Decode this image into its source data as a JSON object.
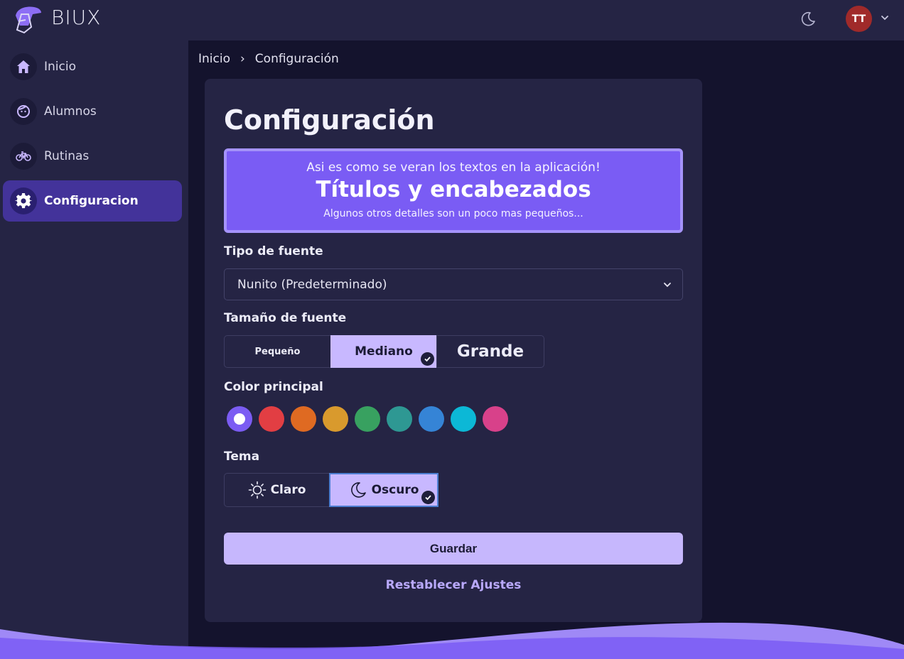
{
  "app": {
    "brand": "BIUX"
  },
  "header": {
    "avatar_initials": "TT",
    "theme_icon": "moon-icon"
  },
  "sidebar": {
    "items": [
      {
        "label": "Inicio",
        "icon": "home-icon",
        "active": false
      },
      {
        "label": "Alumnos",
        "icon": "face-icon",
        "active": false
      },
      {
        "label": "Rutinas",
        "icon": "bicycle-icon",
        "active": false
      },
      {
        "label": "Configuracion",
        "icon": "gear-icon",
        "active": true
      }
    ]
  },
  "breadcrumb": {
    "home": "Inicio",
    "separator": "›",
    "current": "Configuración"
  },
  "page": {
    "title": "Configuración"
  },
  "preview": {
    "line1": "Asi es como se veran los textos en la aplicación!",
    "line2": "Títulos y encabezados",
    "line3": "Algunos otros detalles son un poco mas pequeños..."
  },
  "font_type": {
    "label": "Tipo de fuente",
    "selected": "Nunito (Predeterminado)"
  },
  "font_size": {
    "label": "Tamaño de fuente",
    "options": [
      "Pequeño",
      "Mediano",
      "Grande"
    ],
    "selected": "Mediano"
  },
  "color": {
    "label": "Color principal",
    "swatches": [
      "#7b5cf3",
      "#e23e43",
      "#df6a22",
      "#d99a2d",
      "#38a160",
      "#2e9893",
      "#3584d6",
      "#0cb8d6",
      "#d8418a"
    ],
    "selected_index": 0
  },
  "theme": {
    "label": "Tema",
    "options": [
      {
        "label": "Claro",
        "icon": "sun-icon"
      },
      {
        "label": "Oscuro",
        "icon": "moon-icon"
      }
    ],
    "selected": "Oscuro"
  },
  "actions": {
    "save": "Guardar",
    "reset": "Restablecer Ajustes"
  },
  "colors": {
    "accent": "#7a5cf4",
    "accent_light": "#c6b7fd",
    "background": "#14132d",
    "surface": "#252444"
  }
}
